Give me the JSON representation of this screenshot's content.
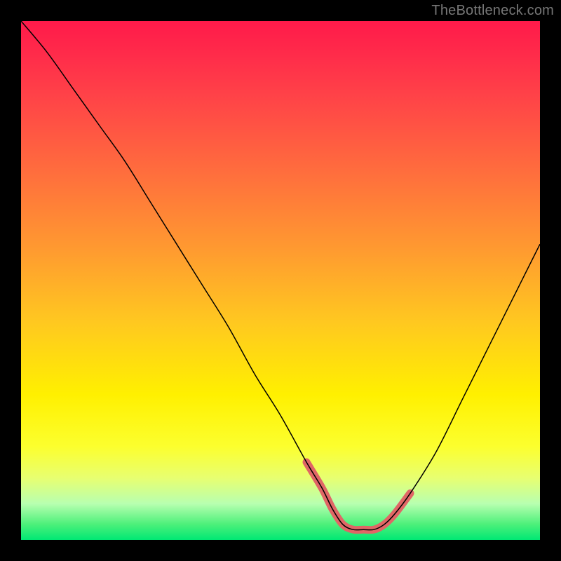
{
  "watermark": "TheBottleneck.com",
  "colors": {
    "background": "#000000",
    "watermark_text": "#777777",
    "curve_thin": "#000000",
    "curve_accent": "#e06666",
    "gradient_stops": [
      "#ff1a4a",
      "#ff2a4a",
      "#ff4148",
      "#ff6a3e",
      "#ff9a30",
      "#ffc820",
      "#fff000",
      "#fcff2e",
      "#e8ff70",
      "#b8ffb0",
      "#4cf07a",
      "#00e874"
    ]
  },
  "chart_data": {
    "type": "line",
    "title": "",
    "xlabel": "",
    "ylabel": "",
    "xlim": [
      0,
      100
    ],
    "ylim": [
      0,
      100
    ],
    "note": "Y axis is bottleneck percentage; color gradient encodes Y (red=100 at top, green=0 at bottom). No axis ticks or numeric labels are rendered.",
    "series": [
      {
        "name": "bottleneck-curve",
        "x": [
          0,
          5,
          10,
          15,
          20,
          25,
          30,
          35,
          40,
          45,
          50,
          55,
          58,
          60,
          62,
          64,
          66,
          68,
          70,
          72,
          75,
          80,
          85,
          90,
          95,
          100
        ],
        "y": [
          100,
          94,
          87,
          80,
          73,
          65,
          57,
          49,
          41,
          32,
          24,
          15,
          10,
          6,
          3,
          2,
          2,
          2,
          3,
          5,
          9,
          17,
          27,
          37,
          47,
          57
        ]
      }
    ],
    "highlight_range": {
      "name": "flat-bottom-accent",
      "x_start": 57,
      "x_end": 73,
      "comment": "Pink thick segment drawn over the near-zero valley"
    }
  }
}
